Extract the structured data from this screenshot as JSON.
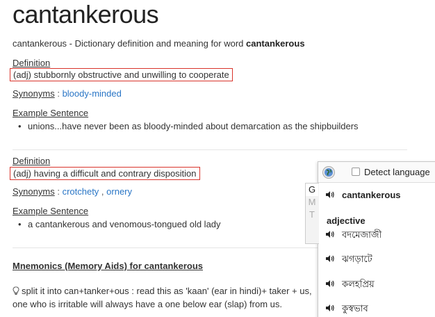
{
  "page": {
    "title": "cantankerous",
    "intro_prefix": "cantankerous - Dictionary definition and meaning for word ",
    "intro_word": "cantankerous"
  },
  "entries": [
    {
      "definition_label": "Definition",
      "definition": "(adj) stubbornly obstructive and unwilling to cooperate",
      "synonyms_label": "Synonyms",
      "synonyms": [
        "bloody-minded"
      ],
      "example_label": "Example Sentence",
      "examples": [
        "unions...have never been as bloody-minded about demarcation as the shipbuilders"
      ]
    },
    {
      "definition_label": "Definition",
      "definition": "(adj) having a difficult and contrary disposition",
      "synonyms_label": "Synonyms",
      "synonyms": [
        "crotchety",
        "ornery"
      ],
      "example_label": "Example Sentence",
      "examples": [
        "a cantankerous and venomous-tongued old lady"
      ]
    }
  ],
  "mnemonics": {
    "title": "Mnemonics (Memory Aids) for cantankerous",
    "line1": "split it into can+tanker+ous : read this as 'kaan' (ear in hindi)+ taker + us,",
    "line2": "one who is irritable will always have a one below ear (slap) from us."
  },
  "translate_popup": {
    "detect_label": "Detect language",
    "tabs": [
      "G",
      "M",
      "T"
    ],
    "word": "cantankerous",
    "part_of_speech": "adjective",
    "translations": [
      "বদমেজাজী",
      "ঝগড়াটে",
      "কলহপ্রিয়",
      "কুস্বভাব"
    ]
  }
}
